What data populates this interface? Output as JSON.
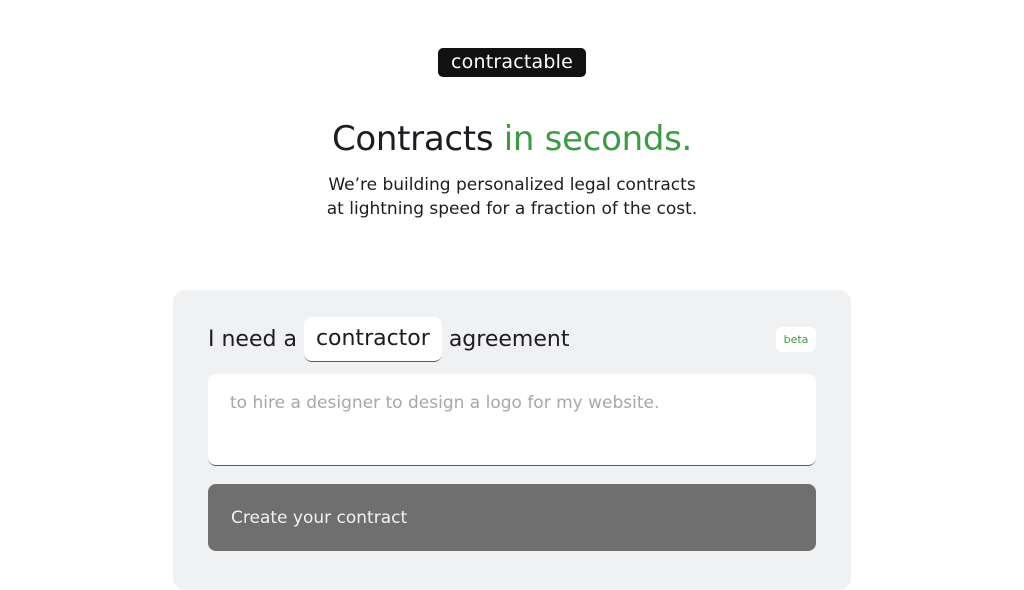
{
  "brand": {
    "logo_text": "contractable"
  },
  "hero": {
    "title_main": "Contracts",
    "title_accent": "in seconds.",
    "subtitle_line1": "We’re building personalized legal contracts",
    "subtitle_line2": "at lightning speed for a fraction of the cost."
  },
  "form": {
    "prefix": "I need a",
    "contract_type": "contractor",
    "suffix": "agreement",
    "beta_label": "beta",
    "description_value": "",
    "description_placeholder": "to hire a designer to design a logo for my website.",
    "submit_label": "Create your contract"
  },
  "colors": {
    "accent": "#3f9a44",
    "logo_bg": "#111111",
    "card_bg": "#f0f1f3",
    "button_bg": "#6f6f6f"
  }
}
